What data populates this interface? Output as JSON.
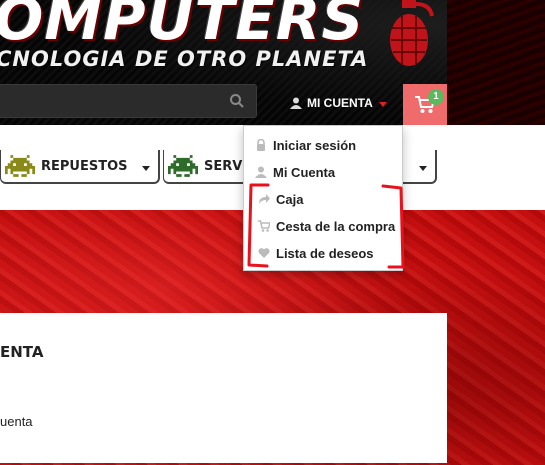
{
  "header": {
    "brand": "OMPUTERS",
    "tagline": "CNOLOGIA DE OTRO PLANETA",
    "search": {
      "value": "",
      "placeholder": ""
    },
    "account_label": "MI CUENTA",
    "cart_count": "1"
  },
  "nav": {
    "items": [
      {
        "label": "REPUESTOS",
        "icon": "space-invader-yellow-icon"
      },
      {
        "label": "SERVI",
        "icon": "space-invader-green-icon"
      }
    ]
  },
  "account_menu": {
    "items": [
      {
        "label": "Iniciar sesión",
        "icon": "lock-icon"
      },
      {
        "label": "Mi Cuenta",
        "icon": "user-icon"
      },
      {
        "label": "Caja",
        "icon": "share-arrow-icon"
      },
      {
        "label": "Cesta de la compra",
        "icon": "cart-icon"
      },
      {
        "label": "Lista de deseos",
        "icon": "heart-icon"
      }
    ]
  },
  "panel": {
    "title": "ENTA",
    "link": "uenta"
  },
  "colors": {
    "cart_bg": "#f06b6b",
    "badge": "#5cb85c",
    "red_texture": "#c40f10",
    "annotation": "#e8111c"
  }
}
